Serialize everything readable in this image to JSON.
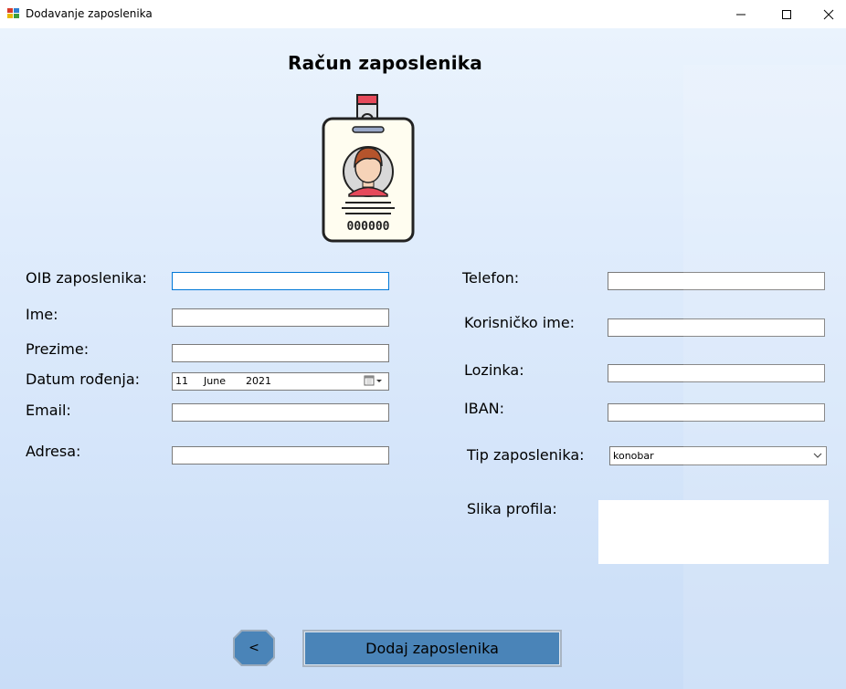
{
  "window": {
    "title": "Dodavanje zaposlenika",
    "minimize_glyph": "minimize-icon",
    "maximize_glyph": "maximize-icon",
    "close_glyph": "close-icon"
  },
  "form": {
    "heading": "Račun zaposlenika",
    "badge_number": "000000",
    "left": {
      "oib_label": "OIB zaposlenika:",
      "ime_label": "Ime:",
      "prezime_label": "Prezime:",
      "datum_label": "Datum rođenja:",
      "email_label": "Email:",
      "adresa_label": "Adresa:",
      "oib_value": "",
      "ime_value": "",
      "prezime_value": "",
      "email_value": "",
      "adresa_value": ""
    },
    "date": {
      "day": "11",
      "month": "June",
      "year": "2021"
    },
    "right": {
      "telefon_label": "Telefon:",
      "korisnicko_label": "Korisničko ime:",
      "lozinka_label": "Lozinka:",
      "iban_label": "IBAN:",
      "tip_label": "Tip zaposlenika:",
      "slika_label": "Slika profila:",
      "telefon_value": "",
      "korisnicko_value": "",
      "lozinka_value": "",
      "iban_value": "",
      "tip_value": "konobar"
    },
    "buttons": {
      "back_label": "<",
      "add_label": "Dodaj zaposlenika"
    }
  },
  "colors": {
    "button_blue": "#4a84b8",
    "focus_border": "#0078d7",
    "badge_red": "#e64a5a",
    "badge_card": "#fffdf0"
  }
}
